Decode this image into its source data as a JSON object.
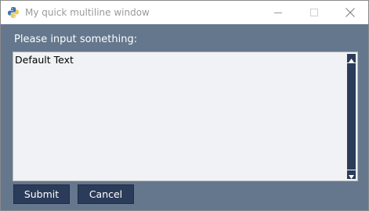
{
  "window": {
    "title": "My quick multiline window",
    "icon": "python-icon"
  },
  "titlebar_buttons": {
    "minimize": "minimize-icon",
    "maximize": "maximize-icon",
    "close": "close-icon"
  },
  "form": {
    "prompt": "Please input something:",
    "textarea_value": "Default Text"
  },
  "buttons": {
    "submit_label": "Submit",
    "cancel_label": "Cancel"
  },
  "colors": {
    "background": "#64778d",
    "button": "#2b3c5a",
    "textarea": "#f0f2f5"
  }
}
